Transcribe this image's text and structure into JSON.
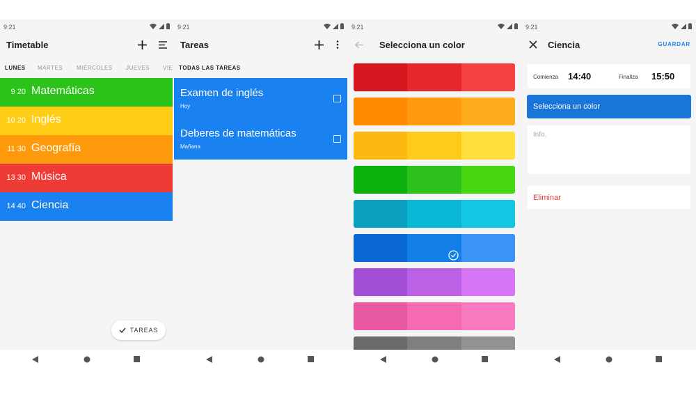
{
  "screen1": {
    "status_time": "9:21",
    "title": "Timetable",
    "days": [
      "LUNES",
      "MARTES",
      "MIÉRCOLES",
      "JUEVES",
      "VIE"
    ],
    "classes": [
      {
        "time": "9 20",
        "name": "Matemáticas",
        "color": "#2bc21a"
      },
      {
        "time": "10 20",
        "name": "Inglés",
        "color": "#ffcc16"
      },
      {
        "time": "11 30",
        "name": "Geografía",
        "color": "#ff9a0d"
      },
      {
        "time": "13 30",
        "name": "Música",
        "color": "#ee3b36"
      },
      {
        "time": "14 40",
        "name": "Ciencia",
        "color": "#1a82f0"
      }
    ],
    "fab_label": "TAREAS"
  },
  "screen2": {
    "status_time": "9:21",
    "title": "Tareas",
    "tab": "TODAS LAS TAREAS",
    "tasks": [
      {
        "name": "Examen de inglés",
        "due": "Hoy"
      },
      {
        "name": "Deberes de matemáticas",
        "due": "Mañana"
      }
    ],
    "panel_color": "#1a82f0"
  },
  "screen3": {
    "status_time": "9:21",
    "title": "Selecciona un color",
    "palette": [
      [
        "#d8161f",
        "#e8272c",
        "#f5413f"
      ],
      [
        "#ff8a00",
        "#ff9b0c",
        "#ffac1f"
      ],
      [
        "#fdb90f",
        "#fecb18",
        "#ffdf39"
      ],
      [
        "#0db10d",
        "#2ec21c",
        "#47d812"
      ],
      [
        "#0aa0bf",
        "#0ab7d5",
        "#14c7e3"
      ],
      [
        "#0a68d4",
        "#137fe8",
        "#3a94f5"
      ],
      [
        "#a24fd6",
        "#bb61e5",
        "#d776f5"
      ],
      [
        "#ea5aa2",
        "#f66ab1",
        "#fb7bc0"
      ],
      [
        "#6a6a6a",
        "#7f7f7f",
        "#929292"
      ]
    ],
    "selected_row": 5,
    "selected_col": 1
  },
  "screen4": {
    "status_time": "9:21",
    "title": "Ciencia",
    "save_label": "GUARDAR",
    "start_label": "Comienza",
    "start_time": "14:40",
    "end_label": "Finaliza",
    "end_time": "15:50",
    "color_button": "Selecciona un color",
    "info_placeholder": "Info.",
    "delete_label": "Eliminar",
    "accent": "#1976d8",
    "delete_color": "#e53935"
  }
}
